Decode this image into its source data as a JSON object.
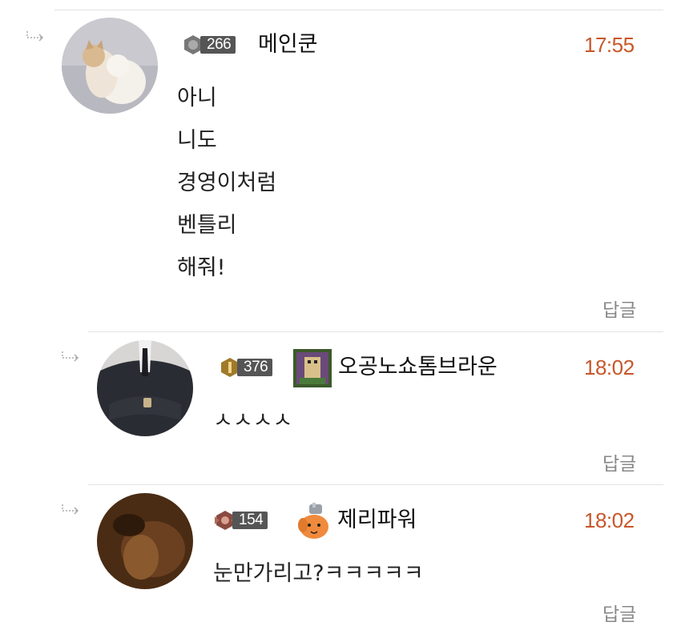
{
  "comments": [
    {
      "level": "266",
      "username": "메인쿤",
      "time": "17:55",
      "lines": [
        "아니",
        "니도",
        "경영이처럼",
        "벤틀리",
        "해줘!"
      ],
      "reply_label": "답글",
      "avatar_icon": "cat-avatar"
    },
    {
      "level": "376",
      "username": "오공노쇼톰브라운",
      "time": "18:02",
      "lines": [
        "ㅅㅅㅅㅅ"
      ],
      "reply_label": "답글",
      "avatar_icon": "suit-avatar",
      "item_icon": "pixel-art-icon"
    },
    {
      "level": "154",
      "username": "제리파워",
      "time": "18:02",
      "lines": [
        "눈만가리고?ㅋㅋㅋㅋㅋ"
      ],
      "reply_label": "답글",
      "avatar_icon": "dark-avatar",
      "item_icon": "chainsaw-dog-icon"
    }
  ],
  "colors": {
    "time": "#c8572a",
    "badge": "#555555",
    "divider": "#e2e2e2"
  }
}
